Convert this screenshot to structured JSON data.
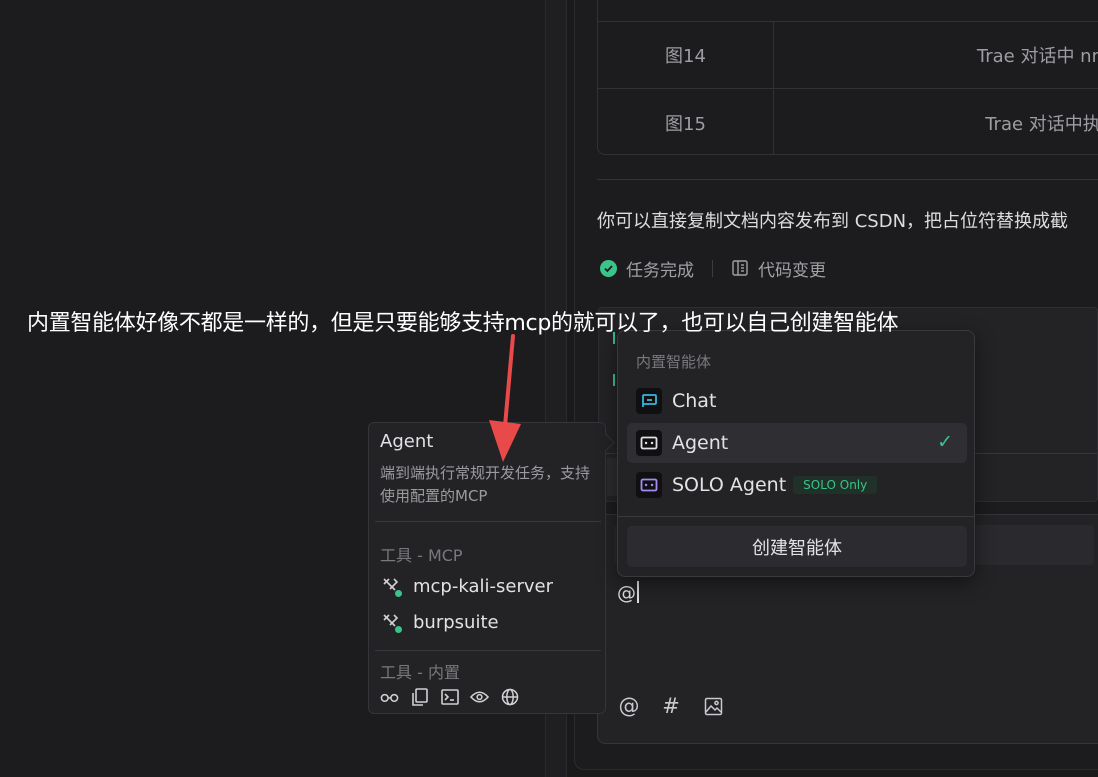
{
  "doc_table": {
    "rows": [
      {
        "label": "图14",
        "desc": "Trae 对话中 nm"
      },
      {
        "label": "图15",
        "desc": "Trae 对话中执"
      }
    ]
  },
  "message": {
    "text": "你可以直接复制文档内容发布到 CSDN，把占位符替换成截",
    "task_status": "任务完成",
    "code_change": "代码变更"
  },
  "annotation": {
    "text": "内置智能体好像不都是一样的，但是只要能够支持mcp的就可以了，也可以自己创建智能体"
  },
  "agent_card": {
    "title": "Agent",
    "description": "端到端执行常规开发任务，支持使用配置的MCP",
    "mcp_section": "工具 - MCP",
    "mcp_tools": [
      "mcp-kali-server",
      "burpsuite"
    ],
    "builtin_section": "工具 - 内置",
    "builtin_icons": [
      "glasses-icon",
      "copy-icon",
      "terminal-icon",
      "preview-icon",
      "globe-icon"
    ]
  },
  "agent_menu": {
    "section_label": "内置智能体",
    "items": [
      {
        "label": "Chat",
        "icon": "chat-icon",
        "selected": false
      },
      {
        "label": "Agent",
        "icon": "agent-icon",
        "selected": true
      },
      {
        "label": "SOLO Agent",
        "icon": "solo-agent-icon",
        "badge": "SOLO Only",
        "selected": false
      }
    ],
    "create_label": "创建智能体"
  },
  "input": {
    "value": "@",
    "tools": [
      "at-icon",
      "hash-icon",
      "image-icon"
    ]
  },
  "colors": {
    "accent_green": "#3ac48a",
    "annotation_arrow": "#e84a4a",
    "background": "#1c1c1e"
  }
}
